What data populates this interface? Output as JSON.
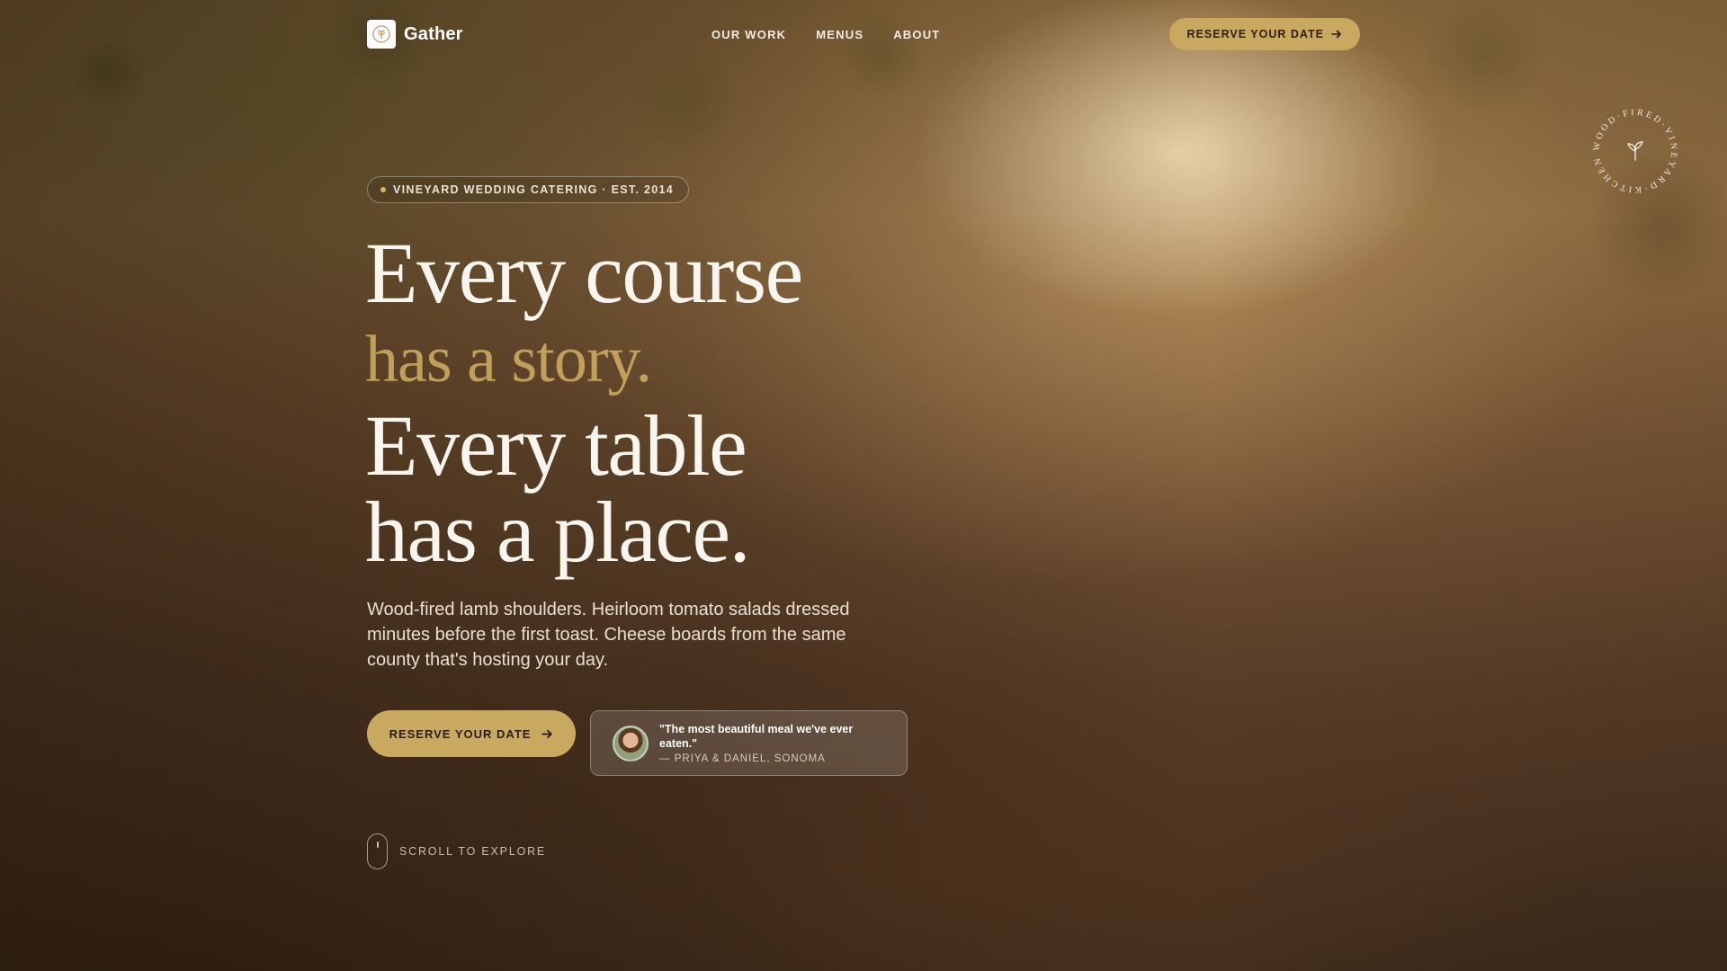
{
  "brand": {
    "name": "Gather",
    "logo_icon": "wheat-wreath-icon"
  },
  "nav": {
    "items": [
      "OUR WORK",
      "MENUS",
      "ABOUT"
    ]
  },
  "header_cta": {
    "label": "RESERVE YOUR DATE",
    "icon": "arrow-right-icon"
  },
  "hero": {
    "eyebrow": "VINEYARD WEDDING CATERING · EST. 2014",
    "headline": {
      "line1": "Every course",
      "line2_accent": "has a story.",
      "line3": "Every table",
      "line4": "has a place."
    },
    "lede": "Wood-fired lamb shoulders. Heirloom tomato salads dressed minutes before the first toast. Cheese boards from the same county that's hosting your day.",
    "cta": {
      "label": "RESERVE YOUR DATE",
      "icon": "arrow-right-icon"
    },
    "testimonial": {
      "quote": "\"The most beautiful meal we've ever eaten.\"",
      "attribution": "— PRIYA & DANIEL, SONOMA"
    },
    "scroll_label": "SCROLL TO EXPLORE"
  },
  "seal": {
    "text": "WOOD·FIRED·VINEYARD·KITCHEN",
    "icon": "sprout-icon"
  },
  "colors": {
    "accent": "#c9a860",
    "accent_text": "#2b1e0e",
    "headline": "#faf6ef"
  }
}
